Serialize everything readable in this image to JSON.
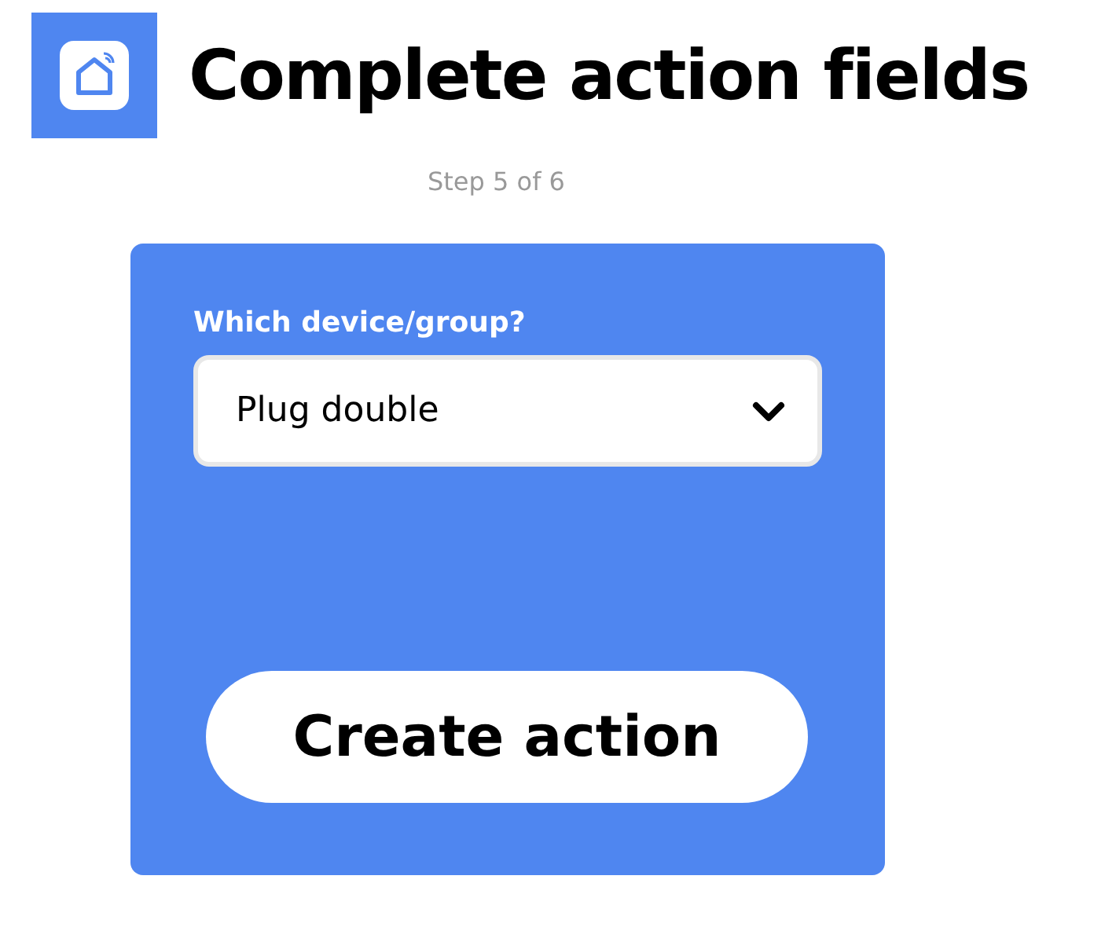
{
  "header": {
    "title": "Complete action fields",
    "step": "Step 5 of 6"
  },
  "form": {
    "field_label": "Which device/group?",
    "select": {
      "value": "Plug double"
    },
    "button": "Create action"
  }
}
